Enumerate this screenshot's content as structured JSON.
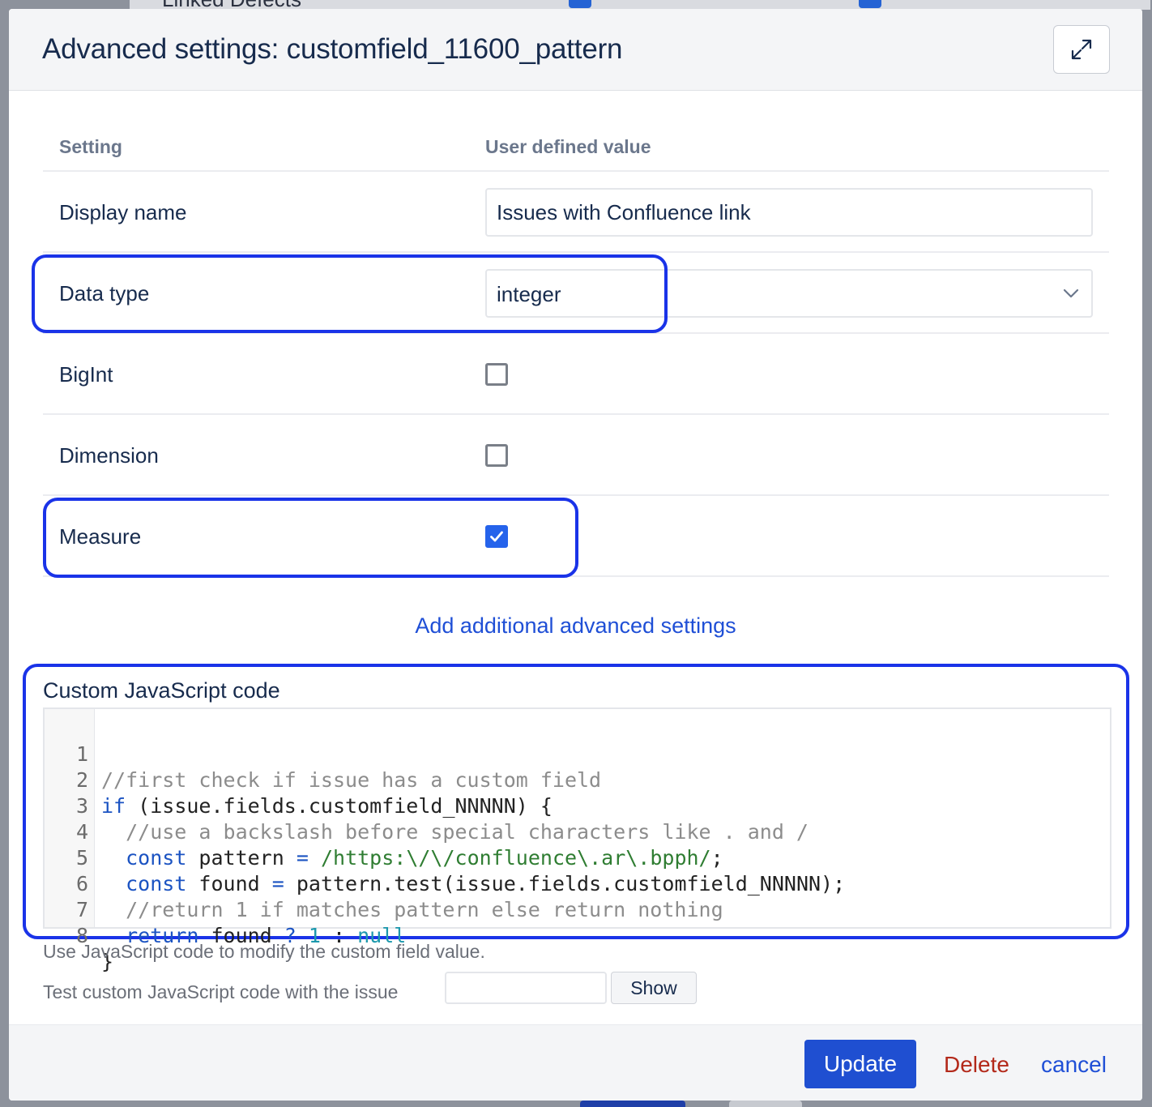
{
  "background": {
    "partial_text": "Linked Defects"
  },
  "modal": {
    "title": "Advanced settings: customfield_11600_pattern",
    "expand_icon": "expand-icon"
  },
  "table": {
    "header_setting": "Setting",
    "header_value": "User defined value",
    "rows": [
      {
        "label": "Display name",
        "value": "Issues with Confluence link"
      },
      {
        "label": "Data type",
        "value": "integer"
      },
      {
        "label": "BigInt",
        "checked": false
      },
      {
        "label": "Dimension",
        "checked": false
      },
      {
        "label": "Measure",
        "checked": true
      }
    ]
  },
  "add_link": "Add additional advanced settings",
  "code_section": {
    "label": "Custom JavaScript code",
    "line_numbers": [
      "1",
      "2",
      "3",
      "4",
      "5",
      "6",
      "7",
      "8"
    ],
    "lines": [
      "//first check if issue has a custom field",
      "if (issue.fields.customfield_NNNNN) {",
      "  //use a backslash before special characters like . and /",
      "  const pattern = /https:\\/\\/confluence\\.ar\\.bpph/;",
      "  const found = pattern.test(issue.fields.customfield_NNNNN);",
      "  //return 1 if matches pattern else return nothing",
      "  return found ? 1 : null",
      "}"
    ],
    "hint": "Use JavaScript code to modify the custom field value.",
    "test_label": "Test custom JavaScript code with the issue",
    "test_placeholder": "",
    "show_label": "Show"
  },
  "footer": {
    "update_label": "Update",
    "delete_label": "Delete",
    "cancel_label": "cancel"
  },
  "colors": {
    "highlight": "#1a33e8",
    "primary": "#1f4fd1",
    "danger": "#b3291a",
    "checkbox_checked": "#2563eb"
  }
}
